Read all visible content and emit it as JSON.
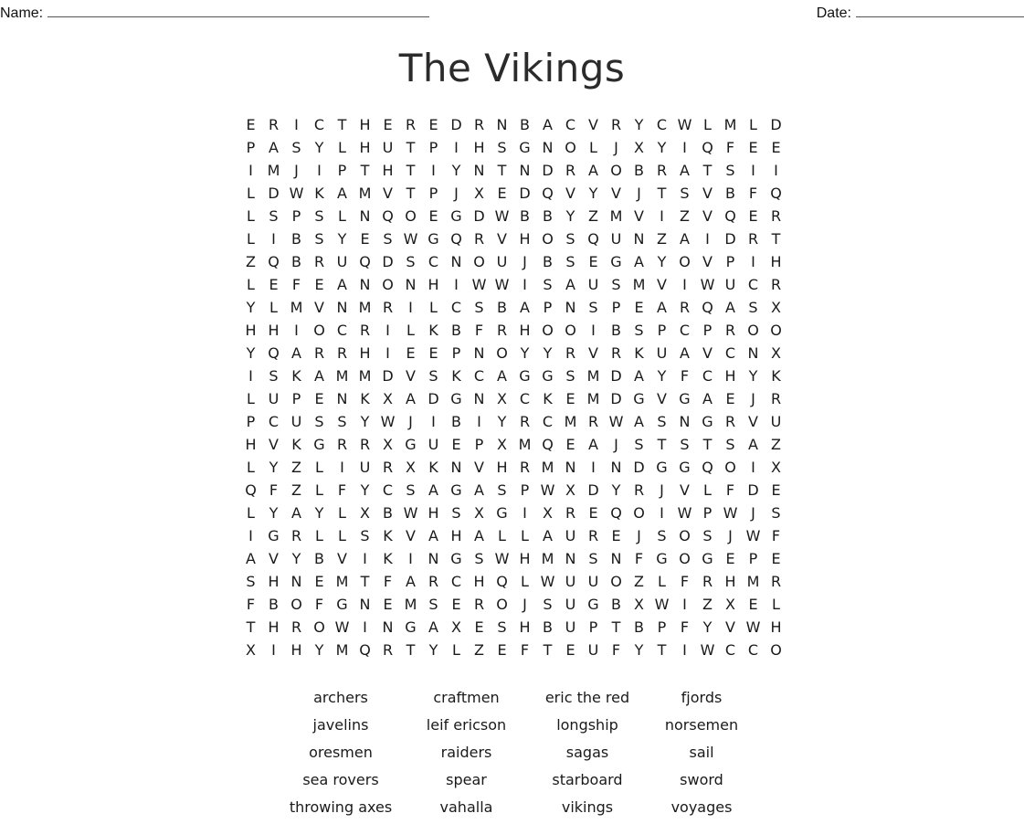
{
  "header": {
    "name_label": "Name:",
    "date_label": "Date:"
  },
  "title": "The Vikings",
  "grid": [
    "ERICTHEREDRNBACVRYCWLMLD",
    "PASYLHUTPIHSGNOLJXYIQFEE",
    "IMJIPTHTIYNTNDRAOBRATSII",
    "LDWKAMVTPJXEDQVYVJTSVBFQ",
    "LSPSLNQOEGDWBBYZMVIZVQER",
    "LIBSYESWGQRVHOSQUNZAIDRT",
    "ZQBRUQDSCNOUJBSEGAYOVPIH",
    "LEFEANONHIWWISAUSMVIWUCR",
    "YLMVNMRILCSBAPNSPEARQASX",
    "HHIOCRILKBFRHOOIBSPCPROO",
    "YQARRHIEEPNOYYRVRKUAVCNX",
    "ISKAMMDVSKCAGGSMDAYFCHYK",
    "LUPENKXADGNXCKEMDGVGAEJR",
    "PCUSSYWJIBIYRCMRWASNGRVU",
    "HVKGRRXGUEPXMQEAJSTSTSAZ",
    "LYZLIURXKNVHRMNINDGGQOIX",
    "QFZLFYCSAGASPWXDYRJVLFDE",
    "LYAYLXBWHSXGIXREQOIWPWJS",
    "IGRLLSKVAHALLAUREJSOSJWF",
    "AVYBVIKINGSWHMNSNFGOGEPE",
    "SHNEMTFARCHQLWUUOZLFRHMR",
    "FBOFGNEMSEROJSUGBXWIZXEL",
    "THROWINGAXESHBUPTBPFYVWH",
    "XIHYMQRTYLZEFTEUFYTIWCCO"
  ],
  "words": [
    "archers",
    "craftmen",
    "eric the red",
    "fjords",
    "javelins",
    "leif ericson",
    "longship",
    "norsemen",
    "oresmen",
    "raiders",
    "sagas",
    "sail",
    "sea rovers",
    "spear",
    "starboard",
    "sword",
    "throwing axes",
    "vahalla",
    "vikings",
    "voyages"
  ]
}
